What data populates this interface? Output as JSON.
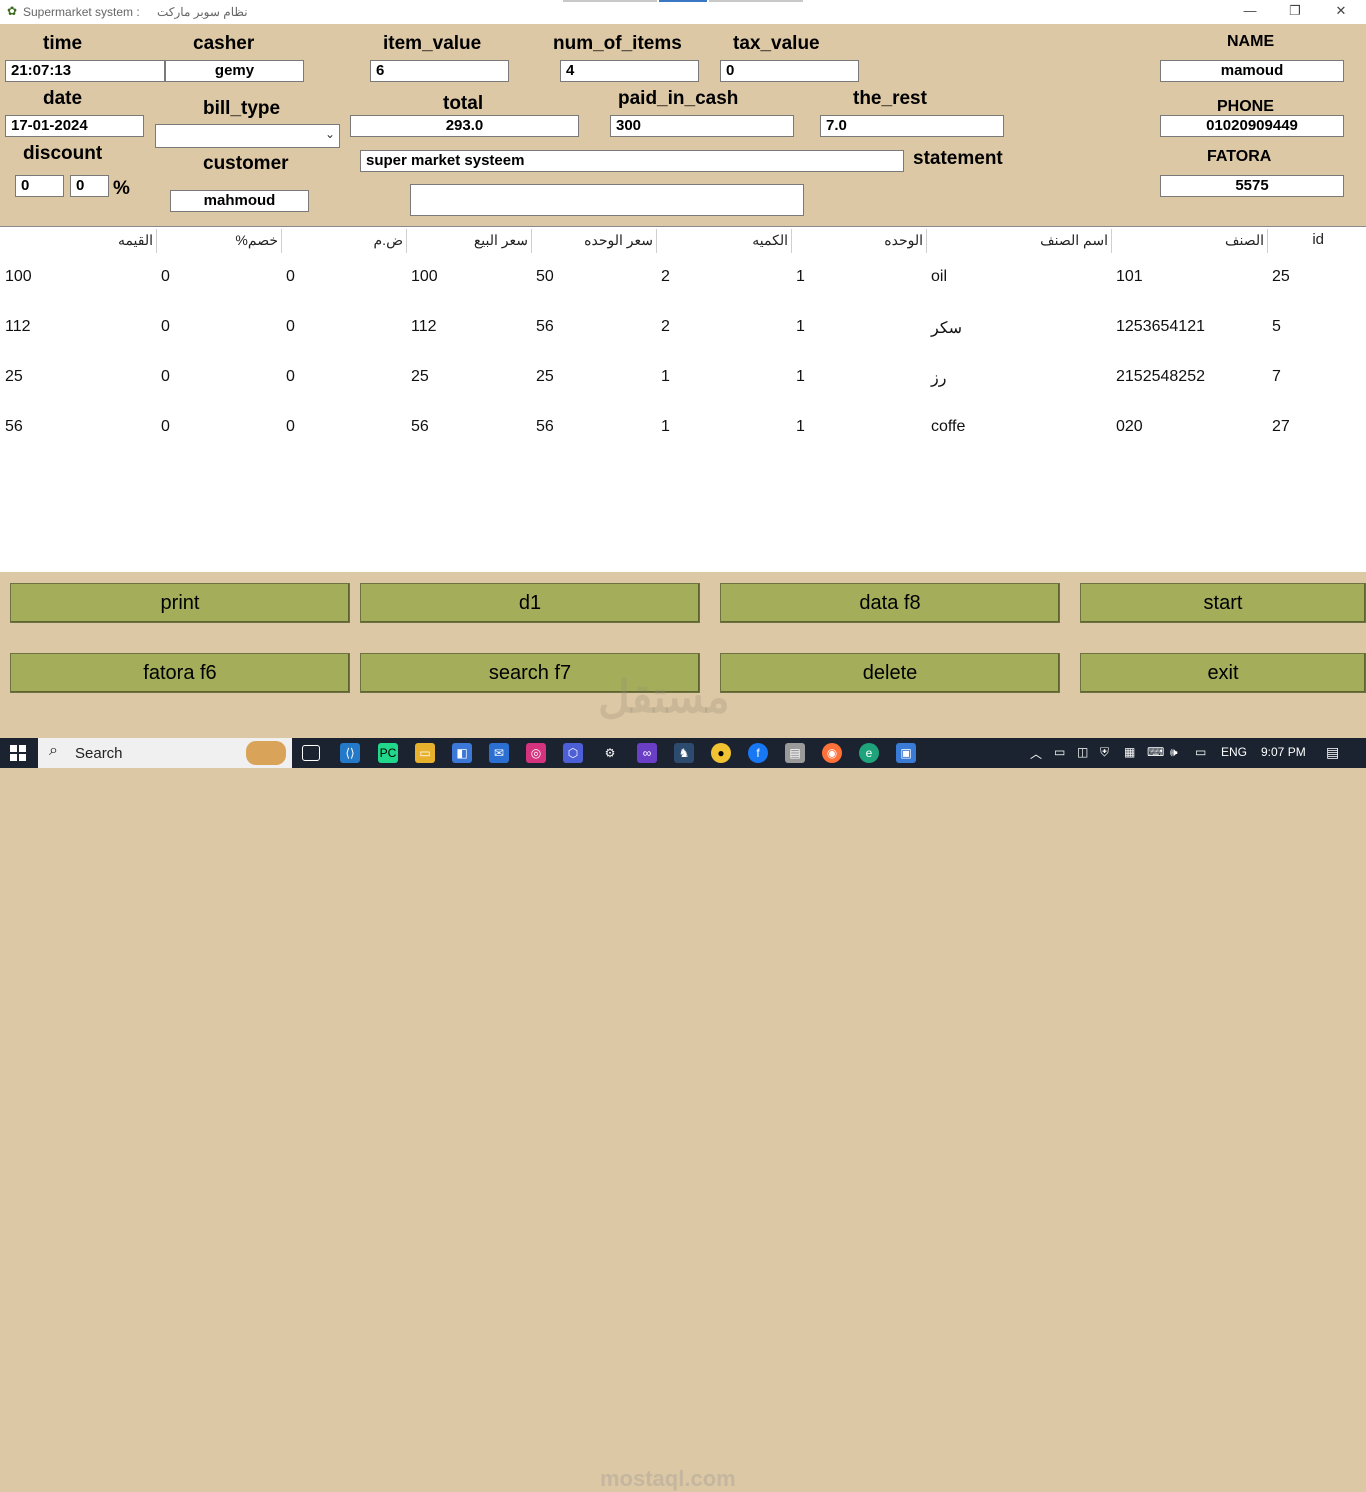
{
  "window": {
    "title": "Supermarket system :",
    "title_ar": "نظام سوبر ماركت",
    "minimize": "—",
    "restore": "❐",
    "close": "✕"
  },
  "form": {
    "time": {
      "label": "time",
      "value": "21:07:13"
    },
    "casher": {
      "label": "casher",
      "value": "gemy"
    },
    "item_value": {
      "label": "item_value",
      "value": "6"
    },
    "num_of_items": {
      "label": "num_of_items",
      "value": "4"
    },
    "tax_value": {
      "label": "tax_value",
      "value": "0"
    },
    "name": {
      "label": "NAME",
      "value": "mamoud"
    },
    "date": {
      "label": "date",
      "value": "17-01-2024"
    },
    "bill_type": {
      "label": "bill_type",
      "value": ""
    },
    "total": {
      "label": "total",
      "value": "293.0"
    },
    "paid_in_cash": {
      "label": "paid_in_cash",
      "value": "300"
    },
    "the_rest": {
      "label": "the_rest",
      "value": "7.0"
    },
    "phone": {
      "label": "PHONE",
      "value": "01020909449"
    },
    "discount": {
      "label": "discount",
      "value1": "0",
      "value2": "0",
      "percent": "%"
    },
    "customer": {
      "label": "customer",
      "value": "mahmoud"
    },
    "statement": {
      "label": "statement",
      "value": "super market systeem",
      "extra": ""
    },
    "fatora": {
      "label": "FATORA",
      "value": "5575"
    }
  },
  "table": {
    "headers": [
      "القيمه",
      "%خصم",
      "ض.م",
      "سعر البيع",
      "سعر الوحده",
      "الكميه",
      "الوحده",
      "اسم الصنف",
      "الصنف",
      "id"
    ],
    "rows": [
      [
        "100",
        "0",
        "0",
        "100",
        "50",
        "2",
        "1",
        "oil",
        "101",
        "25"
      ],
      [
        "112",
        "0",
        "0",
        "112",
        "56",
        "2",
        "1",
        "سكر",
        "1253654121",
        "5"
      ],
      [
        "25",
        "0",
        "0",
        "25",
        "25",
        "1",
        "1",
        "رز",
        "2152548252",
        "7"
      ],
      [
        "56",
        "0",
        "0",
        "56",
        "56",
        "1",
        "1",
        "coffe",
        "020",
        "27"
      ]
    ]
  },
  "buttons": {
    "print": "print",
    "d1": "d1",
    "data": "data f8",
    "start": "start",
    "fatora": "fatora  f6",
    "search": "search f7",
    "delete": "delete",
    "exit": "exit"
  },
  "watermark": {
    "brand_ar": "مستقل",
    "brand_en": "mostaql.com"
  },
  "taskbar": {
    "search": "Search",
    "lang": "ENG",
    "time": "9:07 PM"
  },
  "colors": {
    "background": "#ddc8a5",
    "button": "#a4ad59",
    "taskbar": "#1b2330"
  }
}
